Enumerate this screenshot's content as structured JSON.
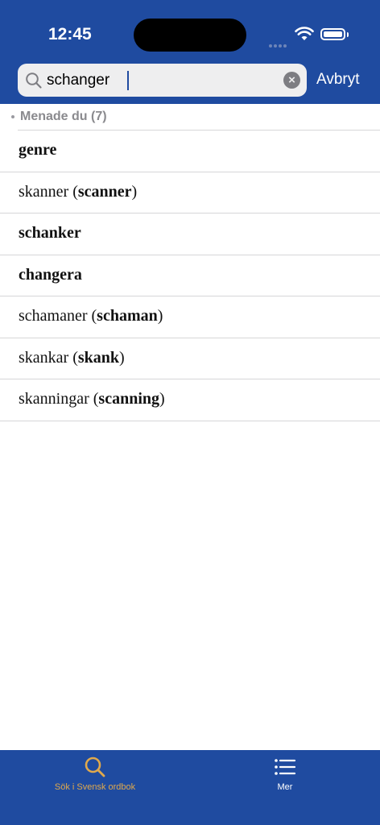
{
  "status_bar": {
    "time": "12:45"
  },
  "search": {
    "query": "schanger",
    "clear_icon": "xmark-circle-icon",
    "cancel_label": "Avbryt"
  },
  "results": {
    "section_label": "Menade du (7)",
    "items": [
      {
        "parts": [
          {
            "text": "genre",
            "bold": true
          }
        ]
      },
      {
        "parts": [
          {
            "text": "skanner (",
            "bold": false
          },
          {
            "text": "scanner",
            "bold": true
          },
          {
            "text": ")",
            "bold": false
          }
        ]
      },
      {
        "parts": [
          {
            "text": "schanker",
            "bold": true
          }
        ]
      },
      {
        "parts": [
          {
            "text": "changera",
            "bold": true
          }
        ]
      },
      {
        "parts": [
          {
            "text": "schamaner (",
            "bold": false
          },
          {
            "text": "schaman",
            "bold": true
          },
          {
            "text": ")",
            "bold": false
          }
        ]
      },
      {
        "parts": [
          {
            "text": "skankar (",
            "bold": false
          },
          {
            "text": "skank",
            "bold": true
          },
          {
            "text": ")",
            "bold": false
          }
        ]
      },
      {
        "parts": [
          {
            "text": "skanningar (",
            "bold": false
          },
          {
            "text": "scanning",
            "bold": true
          },
          {
            "text": ")",
            "bold": false
          }
        ]
      }
    ]
  },
  "tabbar": {
    "search_label": "Sök i Svensk ordbok",
    "more_label": "Mer"
  },
  "colors": {
    "header_bg": "#1f4ba0",
    "active_tab": "#e0a94c"
  }
}
